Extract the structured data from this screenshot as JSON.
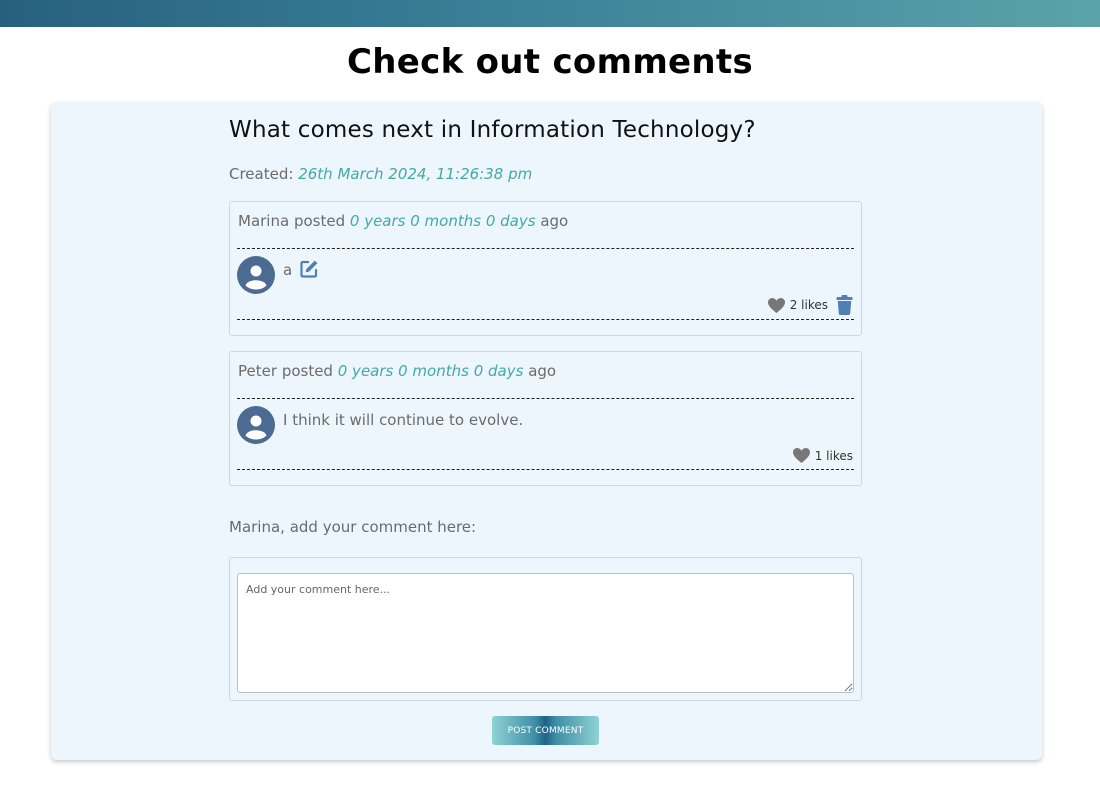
{
  "page": {
    "title": "Check out comments"
  },
  "post": {
    "title": "What comes next in Information Technology?",
    "created_label": "Created:",
    "created_value": "26th March 2024, 11:26:38 pm"
  },
  "comments": [
    {
      "author": "Marina",
      "posted_word": "posted",
      "age": "0 years 0 months 0 days",
      "ago": "ago",
      "text": "a",
      "likes": "2 likes",
      "editable": true,
      "deletable": true
    },
    {
      "author": "Peter",
      "posted_word": "posted",
      "age": "0 years 0 months 0 days",
      "ago": "ago",
      "text": "I think it will continue to evolve.",
      "likes": "1 likes",
      "editable": false,
      "deletable": false
    }
  ],
  "form": {
    "label": "Marina, add your comment here:",
    "placeholder": "Add your comment here...",
    "value": "",
    "submit_label": "POST COMMENT"
  },
  "colors": {
    "accent": "#41aaa4",
    "icon_blue": "#4f7fb4",
    "avatar": "#4b6b93",
    "heart": "#777777"
  },
  "icons": [
    "user-avatar-icon",
    "edit-icon",
    "heart-icon",
    "trash-icon"
  ]
}
